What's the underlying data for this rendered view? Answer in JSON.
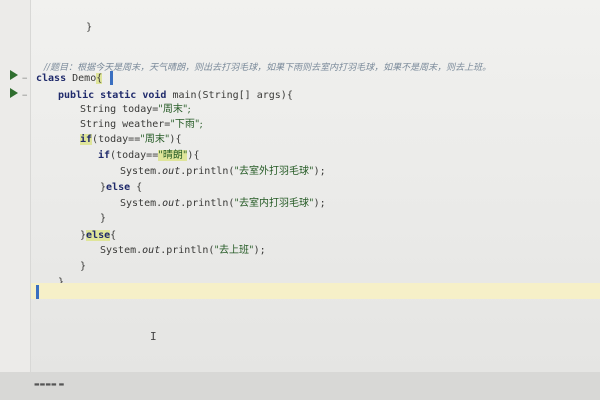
{
  "editor": {
    "comment": "//题目：根据今天是周末，天气晴朗，则出去打羽毛球，如果下雨则去室内打羽毛球，如果不是周末，则去上班。",
    "lines": {
      "class_kw": "class",
      "class_name": "Demo",
      "brace_open": "{",
      "main_sig": "public static void main(String[] args){",
      "main_kw1": "public",
      "main_kw2": "static",
      "main_kw3": "void",
      "main_rest": "main(String[] args){",
      "today_type": "String today=",
      "today_val": "\"周末\";",
      "weather_type": "String weather=",
      "weather_val": "\"下雨\";",
      "if1_kw": "if",
      "if1_open": "(today==",
      "if1_val": "\"周末\"",
      "if1_close": "){",
      "if2_kw": "if",
      "if2_open": "(today==",
      "if2_val": "\"晴朗\"",
      "if2_close": "){",
      "print_a_obj": "System.",
      "print_a_out": "out",
      "print_a_fn": ".println(",
      "print_a_val": "\"去室外打羽毛球\"",
      "print_a_end": ");",
      "else1_a": "}",
      "else1_kw": "else",
      "else1_b": "{",
      "print_b_obj": "System.",
      "print_b_out": "out",
      "print_b_fn": ".println(",
      "print_b_val": "\"去室内打羽毛球\"",
      "print_b_end": ");",
      "close_inner": "}",
      "else2_a": "}",
      "else2_kw": "else",
      "else2_b": "{",
      "print_c_obj": "System.",
      "print_c_out": "out",
      "print_c_fn": ".println(",
      "print_c_val": "\"去上班\"",
      "print_c_end": ");",
      "close_else": "}",
      "close_main": "}",
      "top_brace": "}",
      "text_cursor_glyph": "I"
    }
  },
  "status_bar": {
    "text": "▬▬▬▬ ▬"
  },
  "colors": {
    "background": "#ececea",
    "keyword": "#1f2a6b",
    "string": "#245a24",
    "run_icon": "#2f6e2f",
    "caret": "#3a6fc0"
  }
}
